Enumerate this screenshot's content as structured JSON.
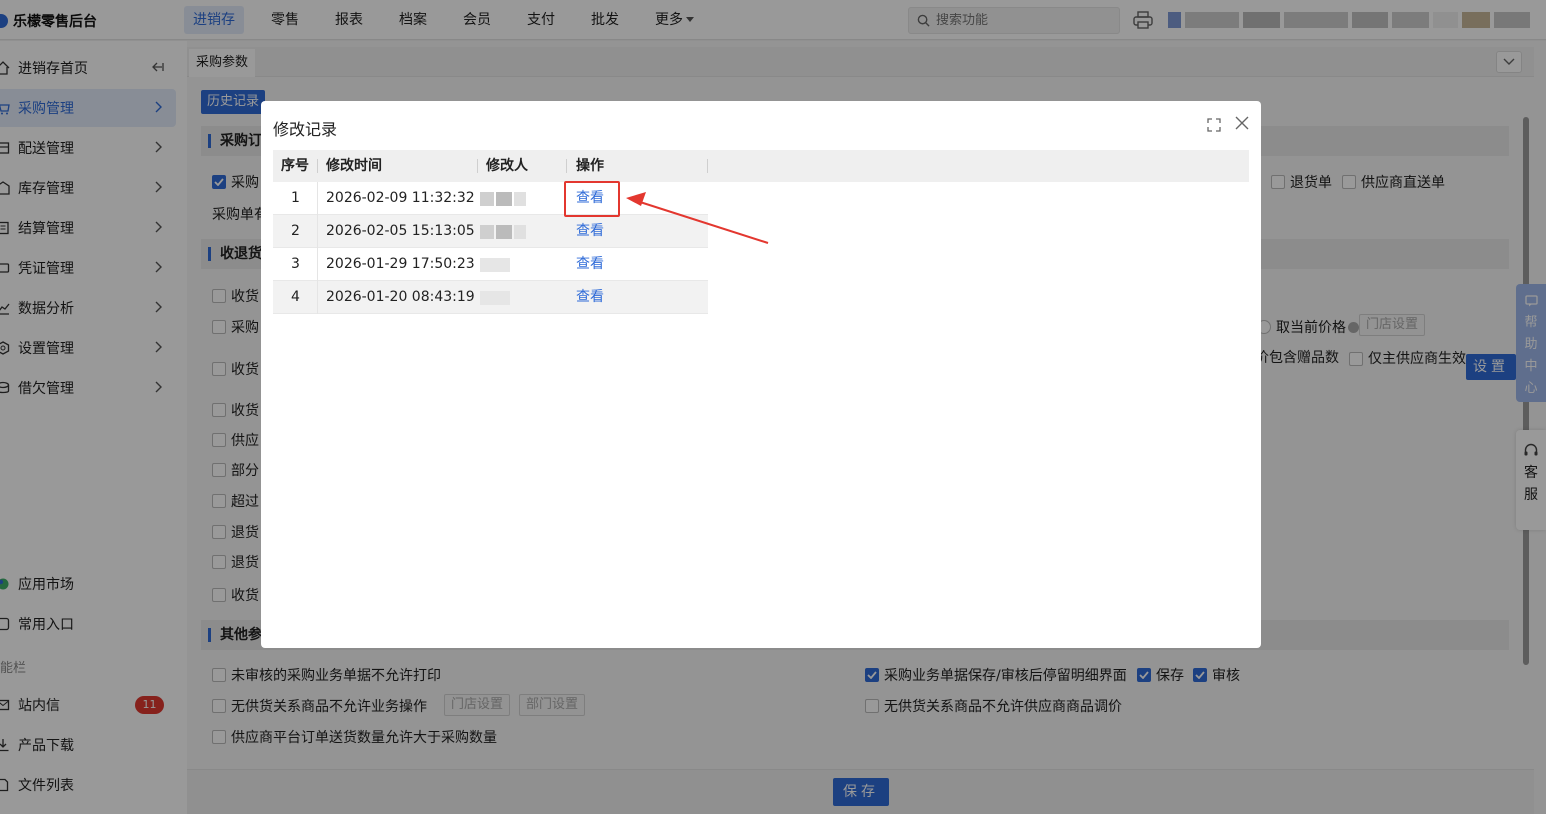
{
  "app": {
    "brand": "乐檬零售后台"
  },
  "topnav": {
    "items": [
      "进销存",
      "零售",
      "报表",
      "档案",
      "会员",
      "支付",
      "批发",
      "更多"
    ],
    "active_index": 0
  },
  "search": {
    "placeholder": "搜索功能"
  },
  "sidebar": {
    "items": [
      {
        "label": "进销存首页",
        "icon": "home-icon"
      },
      {
        "label": "采购管理",
        "icon": "cart-icon"
      },
      {
        "label": "配送管理",
        "icon": "box-icon"
      },
      {
        "label": "库存管理",
        "icon": "warehouse-icon"
      },
      {
        "label": "结算管理",
        "icon": "settlement-icon"
      },
      {
        "label": "凭证管理",
        "icon": "voucher-icon"
      },
      {
        "label": "数据分析",
        "icon": "chart-icon"
      },
      {
        "label": "设置管理",
        "icon": "settings-icon"
      },
      {
        "label": "借欠管理",
        "icon": "debt-icon"
      }
    ],
    "active_index": 1,
    "extras": [
      {
        "label": "应用市场",
        "icon": "app-market-icon"
      },
      {
        "label": "常用入口",
        "icon": "shortcut-icon"
      }
    ],
    "section_label": "能栏",
    "tools": [
      {
        "label": "站内信",
        "icon": "message-icon",
        "badge": "11"
      },
      {
        "label": "产品下载",
        "icon": "download-icon"
      },
      {
        "label": "文件列表",
        "icon": "file-list-icon"
      }
    ]
  },
  "content": {
    "tab_label": "采购参数",
    "history_button": "历史记录",
    "sections": {
      "purchase_order": "采购订",
      "receive_return": "收退货",
      "other_params": "其他参"
    },
    "partial": {
      "purchase_check": "采购",
      "purchase_single": "采购单有",
      "return_order": "退货单",
      "supplier_direct": "供应商直送单",
      "cancel_price": "取当前价格",
      "store_settings": "门店设置",
      "include_gift": "价包含赠品数",
      "only_main_supplier": "仅主供应商生效",
      "set_button": "设置",
      "rows": [
        "收货",
        "采购",
        "收货",
        "收货",
        "供应",
        "部分",
        "超过",
        "退货",
        "退货",
        "收货"
      ]
    },
    "options": {
      "unapproved_no_print": "未审核的采购业务单据不允许打印",
      "no_supply_no_op": "无供货关系商品不允许业务操作",
      "store_settings_btn": "门店设置",
      "dept_settings_btn": "部门设置",
      "supplier_platform_qty": "供应商平台订单送货数量允许大于采购数量",
      "keep_detail": "采购业务单据保存/审核后停留明细界面",
      "save": "保存",
      "approve": "审核",
      "no_supply_no_price": "无供货关系商品不允许供应商商品调价"
    },
    "save_button": "保存"
  },
  "modal": {
    "title": "修改记录",
    "columns": [
      "序号",
      "修改时间",
      "修改人",
      "操作"
    ],
    "rows": [
      {
        "index": "1",
        "time": "2026-02-09 11:32:32",
        "action": "查看"
      },
      {
        "index": "2",
        "time": "2026-02-05 15:13:05",
        "action": "查看"
      },
      {
        "index": "3",
        "time": "2026-01-29 17:50:23",
        "action": "查看"
      },
      {
        "index": "4",
        "time": "2026-01-20 08:43:19",
        "action": "查看"
      }
    ]
  },
  "floats": {
    "help": [
      "帮",
      "助",
      "中",
      "心"
    ],
    "service": [
      "客",
      "服"
    ]
  },
  "colors": {
    "accent": "#2f6bd8",
    "badge": "#e0372f",
    "highlight": "#e3372f"
  }
}
